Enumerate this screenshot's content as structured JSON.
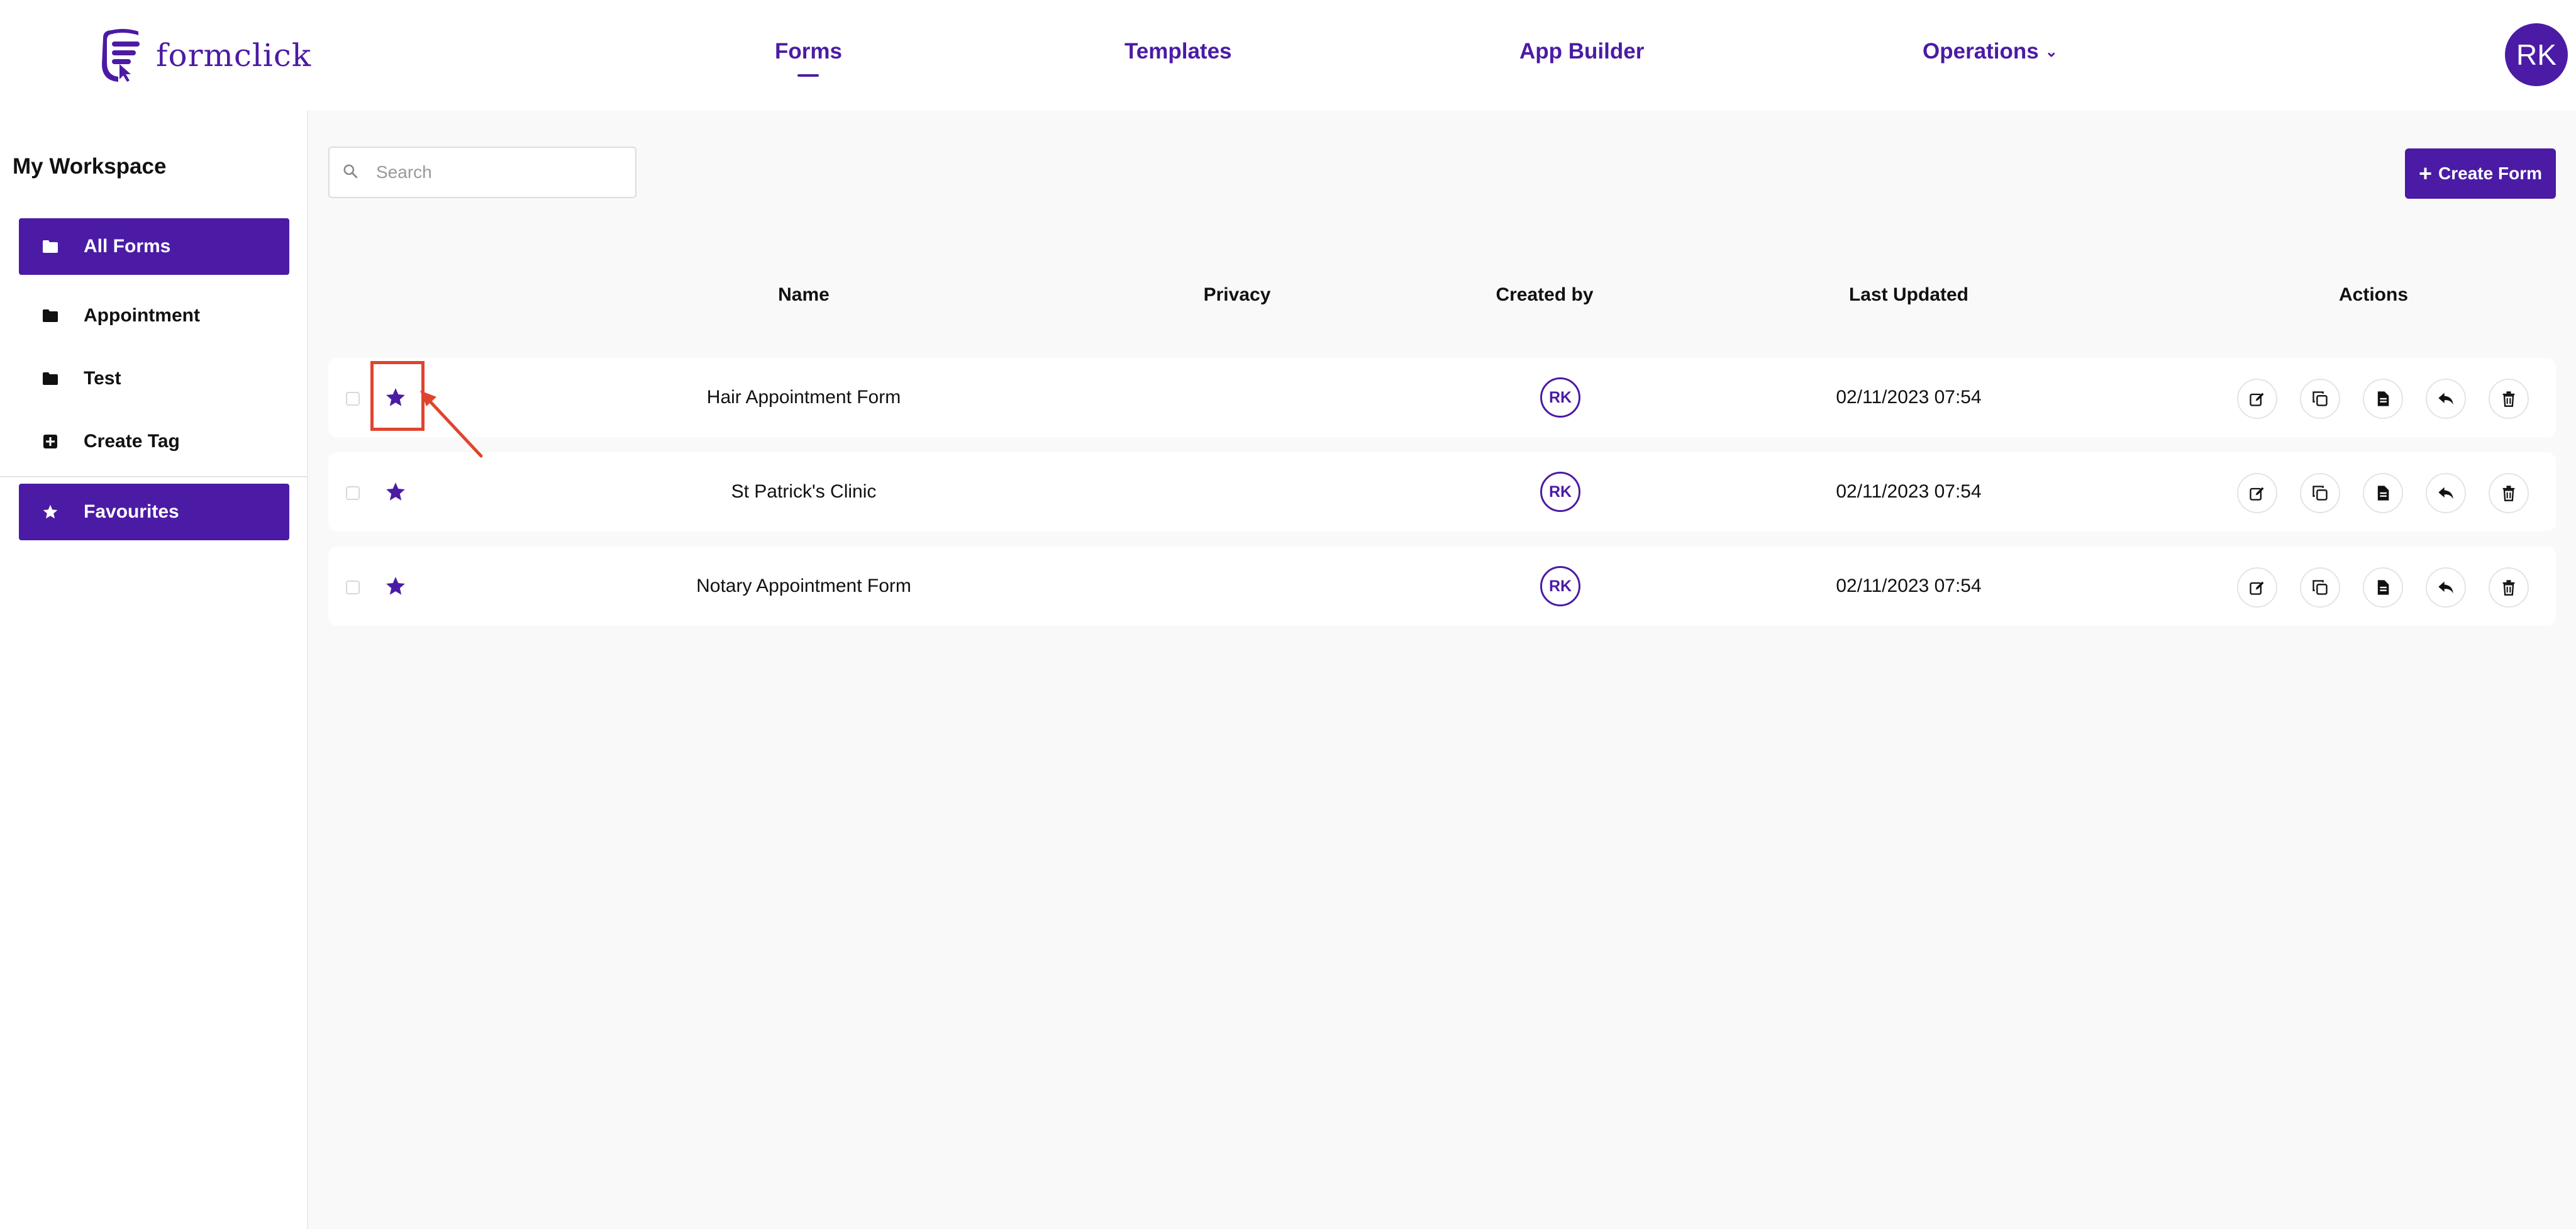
{
  "app": {
    "name": "formclick"
  },
  "nav": {
    "forms": "Forms",
    "templates": "Templates",
    "app_builder": "App Builder",
    "operations": "Operations"
  },
  "user": {
    "initials": "RK"
  },
  "sidebar": {
    "title": "My Workspace",
    "items": [
      {
        "label": "All Forms",
        "icon": "folder-icon",
        "active": true
      },
      {
        "label": "Appointment",
        "icon": "folder-icon",
        "active": false
      },
      {
        "label": "Test",
        "icon": "folder-icon",
        "active": false
      },
      {
        "label": "Create Tag",
        "icon": "plus-square-icon",
        "active": false
      },
      {
        "label": "Favourites",
        "icon": "star-icon",
        "active": true
      }
    ]
  },
  "toolbar": {
    "search_placeholder": "Search",
    "create_label": "Create Form"
  },
  "table": {
    "columns": [
      "Name",
      "Privacy",
      "Created by",
      "Last Updated",
      "Actions"
    ],
    "rows": [
      {
        "name": "Hair Appointment Form",
        "privacy": "",
        "created_by": "RK",
        "last_updated": "02/11/2023 07:54",
        "favourite": true
      },
      {
        "name": "St Patrick's Clinic",
        "privacy": "",
        "created_by": "RK",
        "last_updated": "02/11/2023 07:54",
        "favourite": true
      },
      {
        "name": "Notary Appointment Form",
        "privacy": "",
        "created_by": "RK",
        "last_updated": "02/11/2023 07:54",
        "favourite": true
      }
    ],
    "actions": [
      "edit-icon",
      "duplicate-icon",
      "document-icon",
      "reply-icon",
      "trash-icon"
    ]
  },
  "colors": {
    "brand": "#4b1ba5",
    "highlight": "#e0432d",
    "background": "#f9f9f9"
  }
}
